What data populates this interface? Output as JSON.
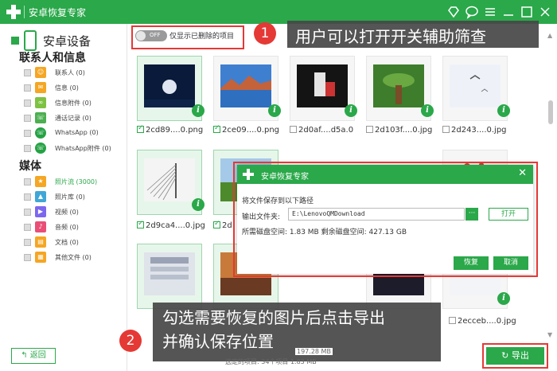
{
  "window": {
    "title": "安卓恢复专家",
    "controls": [
      "diamond-icon",
      "chat-icon",
      "menu-icon",
      "minimize-icon",
      "maximize-icon",
      "close-icon"
    ]
  },
  "sidebar": {
    "device_name": "安卓设备",
    "section_contacts": "联系人和信息",
    "contacts_items": [
      {
        "label": "联系人 (0)",
        "icon": "contacts-icon",
        "color": "#f5a623"
      },
      {
        "label": "信息 (0)",
        "icon": "message-icon",
        "color": "#f5a623"
      },
      {
        "label": "信息附件 (0)",
        "icon": "attachment-icon",
        "color": "#7ec242"
      },
      {
        "label": "通话记录 (0)",
        "icon": "call-log-icon",
        "color": "#4caf50"
      },
      {
        "label": "WhatsApp (0)",
        "icon": "whatsapp-icon",
        "color": "#25a244"
      },
      {
        "label": "WhatsApp附件 (0)",
        "icon": "whatsapp-attachment-icon",
        "color": "#25a244"
      }
    ],
    "section_media": "媒体",
    "media_items": [
      {
        "label": "照片流 (3000)",
        "icon": "photo-stream-icon",
        "color": "#f5a623"
      },
      {
        "label": "照片库 (0)",
        "icon": "photo-library-icon",
        "color": "#3fa7d6"
      },
      {
        "label": "视频 (0)",
        "icon": "video-icon",
        "color": "#7b68ee"
      },
      {
        "label": "音频 (0)",
        "icon": "audio-icon",
        "color": "#e94e77"
      },
      {
        "label": "文档 (0)",
        "icon": "document-icon",
        "color": "#f5a623"
      },
      {
        "label": "其他文件 (0)",
        "icon": "other-files-icon",
        "color": "#f5a623"
      }
    ],
    "back_label": "返回"
  },
  "toolbar": {
    "toggle_text": "OFF",
    "filter_label": "仅显示已删除的项目"
  },
  "thumbnails": [
    {
      "name": "2cd89....0.png",
      "checked": true
    },
    {
      "name": "2ce09....0.png",
      "checked": true
    },
    {
      "name": "2d0af....d5a.0",
      "checked": false
    },
    {
      "name": "2d103f....0.jpg",
      "checked": false
    },
    {
      "name": "2d243....0.jpg",
      "checked": false
    },
    {
      "name": "2d9ca4....0.jpg",
      "checked": true
    },
    {
      "name": "2d",
      "checked": true
    },
    {
      "name": "2ecceb....0.jpg",
      "checked": false
    }
  ],
  "callouts": {
    "tip1_number": "1",
    "tip1_text": "用户可以打开开关辅助筛查",
    "tip2_number": "2",
    "tip2_line1": "勾选需要恢复的图片后点击导出",
    "tip2_line2": "并确认保存位置"
  },
  "dialog": {
    "title": "安卓恢复专家",
    "message": "将文件保存到以下路径",
    "output_label": "输出文件夹:",
    "path_value": "E:\\LenovoQMDownload",
    "browse_label": "···",
    "open_label": "打开",
    "space_text": "所需磁盘空间:  1.83 MB  剩余磁盘空间:  427.13 GB",
    "recover_label": "恢复",
    "cancel_label": "取消"
  },
  "status": {
    "total_partial": "197.28 MB",
    "selected": "选定的项目: 34个项目 1.83 MB"
  },
  "export_label": "导出",
  "colors": {
    "accent": "#2aa84a",
    "highlight": "#e53935"
  }
}
